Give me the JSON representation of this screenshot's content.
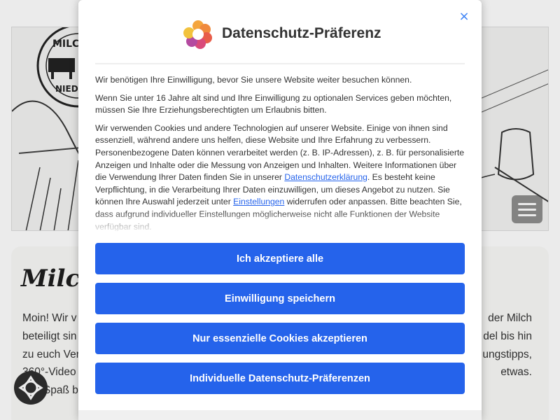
{
  "background": {
    "logo_text_top": "MILC",
    "logo_text_bottom": "NIEDE",
    "heading": "Milch",
    "text_lines_left": [
      "Moin! Wir v",
      "beteiligt sin",
      "zu euch Ver",
      "360°-Video",
      "Viel Spaß b"
    ],
    "text_lines_right": [
      "der Milch",
      "del bis hin",
      "ungstipps,",
      "etwas."
    ]
  },
  "modal": {
    "title": "Datenschutz-Präferenz",
    "close_label": "×",
    "paragraph1": "Wir benötigen Ihre Einwilligung, bevor Sie unsere Website weiter besuchen können.",
    "paragraph2": "Wenn Sie unter 16 Jahre alt sind und Ihre Einwilligung zu optionalen Services geben möchten, müssen Sie Ihre Erziehungsberechtigten um Erlaubnis bitten.",
    "paragraph3_part1": "Wir verwenden Cookies und andere Technologien auf unserer Website. Einige von ihnen sind essenziell, während andere uns helfen, diese Website und Ihre Erfahrung zu verbessern. Personenbezogene Daten können verarbeitet werden (z. B. IP-Adressen), z. B. für personalisierte Anzeigen und Inhalte oder die Messung von Anzeigen und Inhalten. Weitere Informationen über die Verwendung Ihrer Daten finden Sie in unserer ",
    "privacy_link": "Datenschutzerklärung",
    "paragraph3_part2": ". Es besteht keine Verpflichtung, in die Verarbeitung Ihrer Daten einzuwilligen, um dieses Angebot zu nutzen. Sie können Ihre Auswahl jederzeit unter ",
    "settings_link": "Einstellungen",
    "paragraph3_part3": " widerrufen oder anpassen. Bitte beachten Sie, dass aufgrund individueller Einstellungen möglicherweise nicht alle Funktionen der Website verfügbar sind.",
    "buttons": {
      "accept_all": "Ich akzeptiere alle",
      "save_consent": "Einwilligung speichern",
      "essential_only": "Nur essenzielle Cookies akzeptieren",
      "individual": "Individuelle Datenschutz-Präferenzen"
    }
  },
  "colors": {
    "accent": "#2563eb",
    "close_icon": "#3b82f6"
  },
  "icons": [
    "datenschutz-logo-icon",
    "close-icon",
    "menu-icon",
    "privacy-badge-icon"
  ]
}
